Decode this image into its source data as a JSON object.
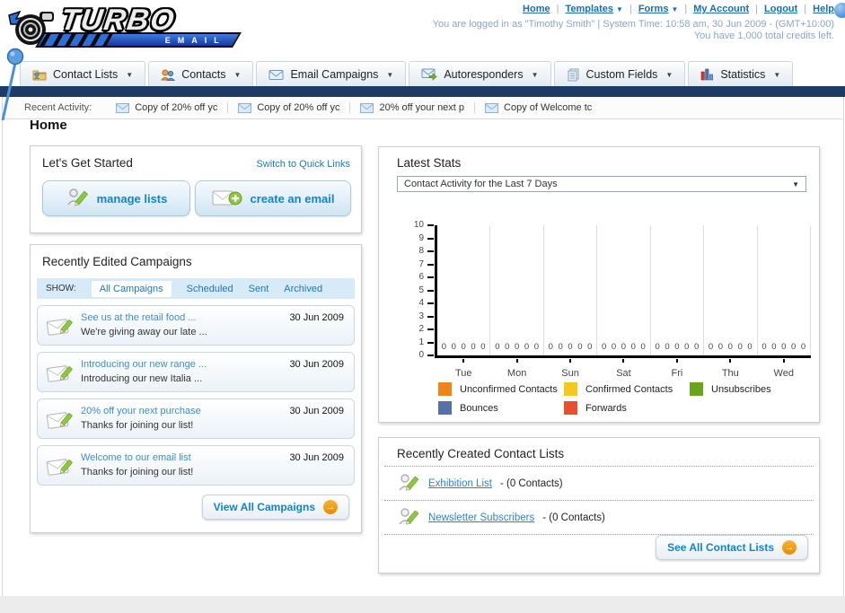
{
  "header": {
    "logo_title": "TURBO",
    "logo_subtitle": "EMAIL",
    "nav": [
      {
        "label": "Home",
        "arrow": false
      },
      {
        "label": "Templates",
        "arrow": true
      },
      {
        "label": "Forms",
        "arrow": true
      },
      {
        "label": "My Account",
        "arrow": false
      },
      {
        "label": "Logout",
        "arrow": false
      },
      {
        "label": "Help",
        "arrow": false
      }
    ],
    "login_status": "You are logged in as \"Timothy Smith\" | System Time: 10:58 am, 30 Jun 2009 - (GMT+10:00)",
    "credits_note": "You have 1,000 total credits left."
  },
  "main_nav": {
    "items": [
      {
        "label": "Contact Lists",
        "icon": "contact-lists-icon"
      },
      {
        "label": "Contacts",
        "icon": "contacts-icon"
      },
      {
        "label": "Email Campaigns",
        "icon": "email-campaigns-icon"
      },
      {
        "label": "Autoresponders",
        "icon": "autoresponders-icon"
      },
      {
        "label": "Custom Fields",
        "icon": "custom-fields-icon"
      },
      {
        "label": "Statistics",
        "icon": "statistics-icon"
      }
    ]
  },
  "recent_activity": {
    "label": "Recent Activity:",
    "items": [
      "Copy of 20% off yc",
      "Copy of 20% off yc",
      "20% off your next p",
      "Copy of Welcome tc"
    ]
  },
  "page_title": "Home",
  "get_started": {
    "title": "Let's Get Started",
    "switch_link": "Switch to Quick Links",
    "manage_lists_label": "manage lists",
    "create_email_label": "create an email"
  },
  "campaigns": {
    "title": "Recently Edited Campaigns",
    "show_label": "SHOW:",
    "filters": [
      {
        "label": "All Campaigns",
        "active": true
      },
      {
        "label": "Scheduled",
        "active": false
      },
      {
        "label": "Sent",
        "active": false
      },
      {
        "label": "Archived",
        "active": false
      }
    ],
    "items": [
      {
        "title": "See us at the retail food ...",
        "subtitle": "We're giving away our late ...",
        "date": "30 Jun 2009"
      },
      {
        "title": "Introducing our new range ...",
        "subtitle": "Introducing our new Italia ...",
        "date": "30 Jun 2009"
      },
      {
        "title": "20% off your next purchase",
        "subtitle": "Thanks for joining our list!",
        "date": "30 Jun 2009"
      },
      {
        "title": "Welcome to our email list",
        "subtitle": "Thanks for joining our list!",
        "date": "30 Jun 2009"
      }
    ],
    "view_all_label": "View All Campaigns"
  },
  "latest_stats": {
    "title": "Latest Stats",
    "dropdown_value": "Contact Activity for the Last 7 Days"
  },
  "chart_data": {
    "type": "bar",
    "title": "Contact Activity for the Last 7 Days",
    "categories": [
      "Tue",
      "Mon",
      "Sun",
      "Sat",
      "Fri",
      "Thu",
      "Wed"
    ],
    "series": [
      {
        "name": "Unconfirmed Contacts",
        "color": "#f08419",
        "values": [
          0,
          0,
          0,
          0,
          0,
          0,
          0
        ]
      },
      {
        "name": "Confirmed Contacts",
        "color": "#f5c81f",
        "values": [
          0,
          0,
          0,
          0,
          0,
          0,
          0
        ]
      },
      {
        "name": "Unsubscribes",
        "color": "#69a41e",
        "values": [
          0,
          0,
          0,
          0,
          0,
          0,
          0
        ]
      },
      {
        "name": "Bounces",
        "color": "#5572a8",
        "values": [
          0,
          0,
          0,
          0,
          0,
          0,
          0
        ]
      },
      {
        "name": "Forwards",
        "color": "#e8502d",
        "values": [
          0,
          0,
          0,
          0,
          0,
          0,
          0
        ]
      }
    ],
    "xlabel": "",
    "ylabel": "",
    "ylim": [
      0,
      10
    ],
    "ytick_step": 1,
    "value_labels_shown": true,
    "grid": "vertical-separators",
    "legend_position": "bottom"
  },
  "contact_lists": {
    "title": "Recently Created Contact Lists",
    "items": [
      {
        "name": "Exhibition List",
        "suffix": " - (0 Contacts)"
      },
      {
        "name": "Newsletter Subscribers",
        "suffix": " - (0 Contacts)"
      }
    ],
    "see_all_label": "See All Contact Lists"
  },
  "colors": {
    "navy_bar": "#1c3c66",
    "link_blue": "#1b6fa8",
    "button_text_blue": "#1583c4",
    "show_bar_bg": "#d7eaf8",
    "footer_strip": "#ececec",
    "orange_arrow": "#f09a10"
  }
}
